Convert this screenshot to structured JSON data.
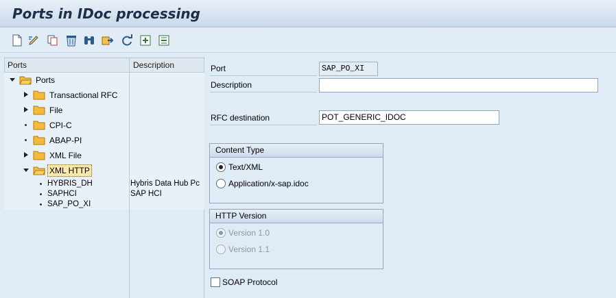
{
  "window": {
    "title": "Ports in IDoc processing"
  },
  "toolbar": {
    "icons": [
      "new-document-icon",
      "change-icon",
      "copy-icon",
      "delete-icon",
      "find-icon",
      "export-icon",
      "refresh-icon",
      "expand-icon",
      "collapse-icon"
    ]
  },
  "tree": {
    "columns": {
      "ports": "Ports",
      "description": "Description"
    },
    "root": {
      "label": "Ports"
    },
    "nodes": [
      {
        "label": "Transactional RFC"
      },
      {
        "label": "File"
      },
      {
        "label": "CPI-C"
      },
      {
        "label": "ABAP-PI"
      },
      {
        "label": "XML File"
      },
      {
        "label": "XML HTTP"
      }
    ],
    "leaves": [
      {
        "label": "HYBRIS_DH",
        "description": "Hybris Data Hub Pc"
      },
      {
        "label": "SAPHCI",
        "description": "SAP HCI"
      },
      {
        "label": "SAP_PO_XI",
        "description": ""
      }
    ]
  },
  "detail": {
    "port": {
      "label": "Port",
      "value": "SAP_PO_XI"
    },
    "description": {
      "label": "Description",
      "value": ""
    },
    "rfc_destination": {
      "label": "RFC destination",
      "value": "POT_GENERIC_IDOC"
    },
    "content_type": {
      "title": "Content Type",
      "options": [
        {
          "label": "Text/XML",
          "checked": true
        },
        {
          "label": "Application/x-sap.idoc",
          "checked": false
        }
      ]
    },
    "http_version": {
      "title": "HTTP Version",
      "options": [
        {
          "label": "Version 1.0",
          "checked": true
        },
        {
          "label": "Version 1.1",
          "checked": false
        }
      ]
    },
    "soap_protocol": {
      "label": "SOAP Protocol",
      "checked": false
    }
  },
  "colors": {
    "folder": "#f5b93b",
    "selected_node_bg": "#fde9a8",
    "background": "#dfebf5"
  }
}
